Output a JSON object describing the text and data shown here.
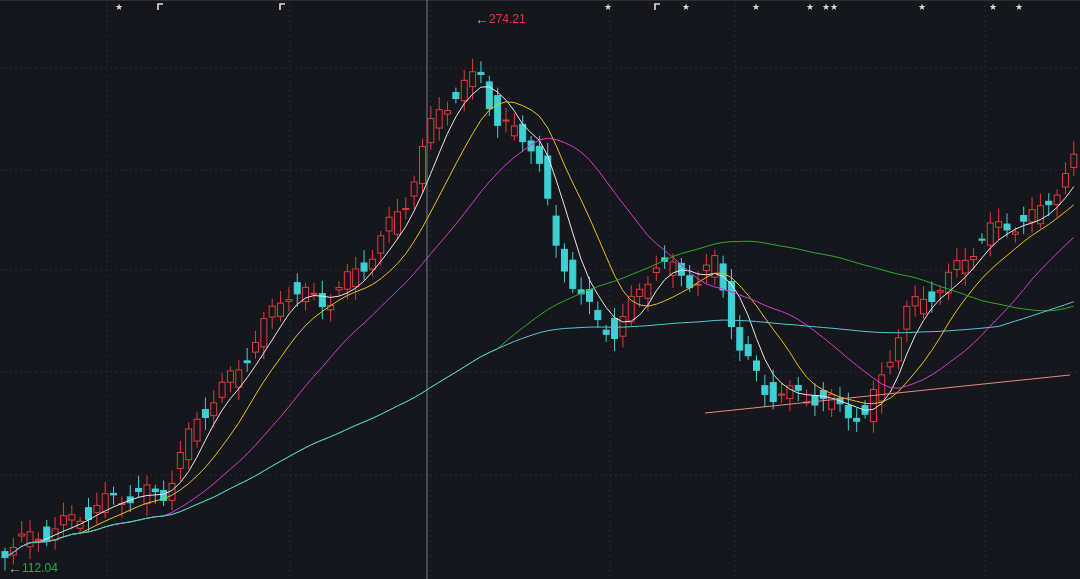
{
  "event_markers": [
    {
      "kind": "star",
      "symbol": "★"
    },
    {
      "kind": "flag"
    },
    {
      "kind": "flag"
    },
    {
      "kind": "star",
      "symbol": "★"
    },
    {
      "kind": "flag"
    },
    {
      "kind": "star",
      "symbol": "★"
    },
    {
      "kind": "star",
      "symbol": "★"
    },
    {
      "kind": "star",
      "symbol": "★"
    },
    {
      "kind": "star",
      "symbol": "★"
    },
    {
      "kind": "star",
      "symbol": "★"
    },
    {
      "kind": "star",
      "symbol": "★"
    },
    {
      "kind": "star",
      "symbol": "★"
    },
    {
      "kind": "star",
      "symbol": "★"
    }
  ],
  "price_markers": [
    {
      "kind": "high",
      "arrow": "←",
      "price": "274.21",
      "color": "#e8363f"
    },
    {
      "kind": "low",
      "arrow": "←",
      "price": "112.04",
      "color": "#1fb04a"
    }
  ]
}
